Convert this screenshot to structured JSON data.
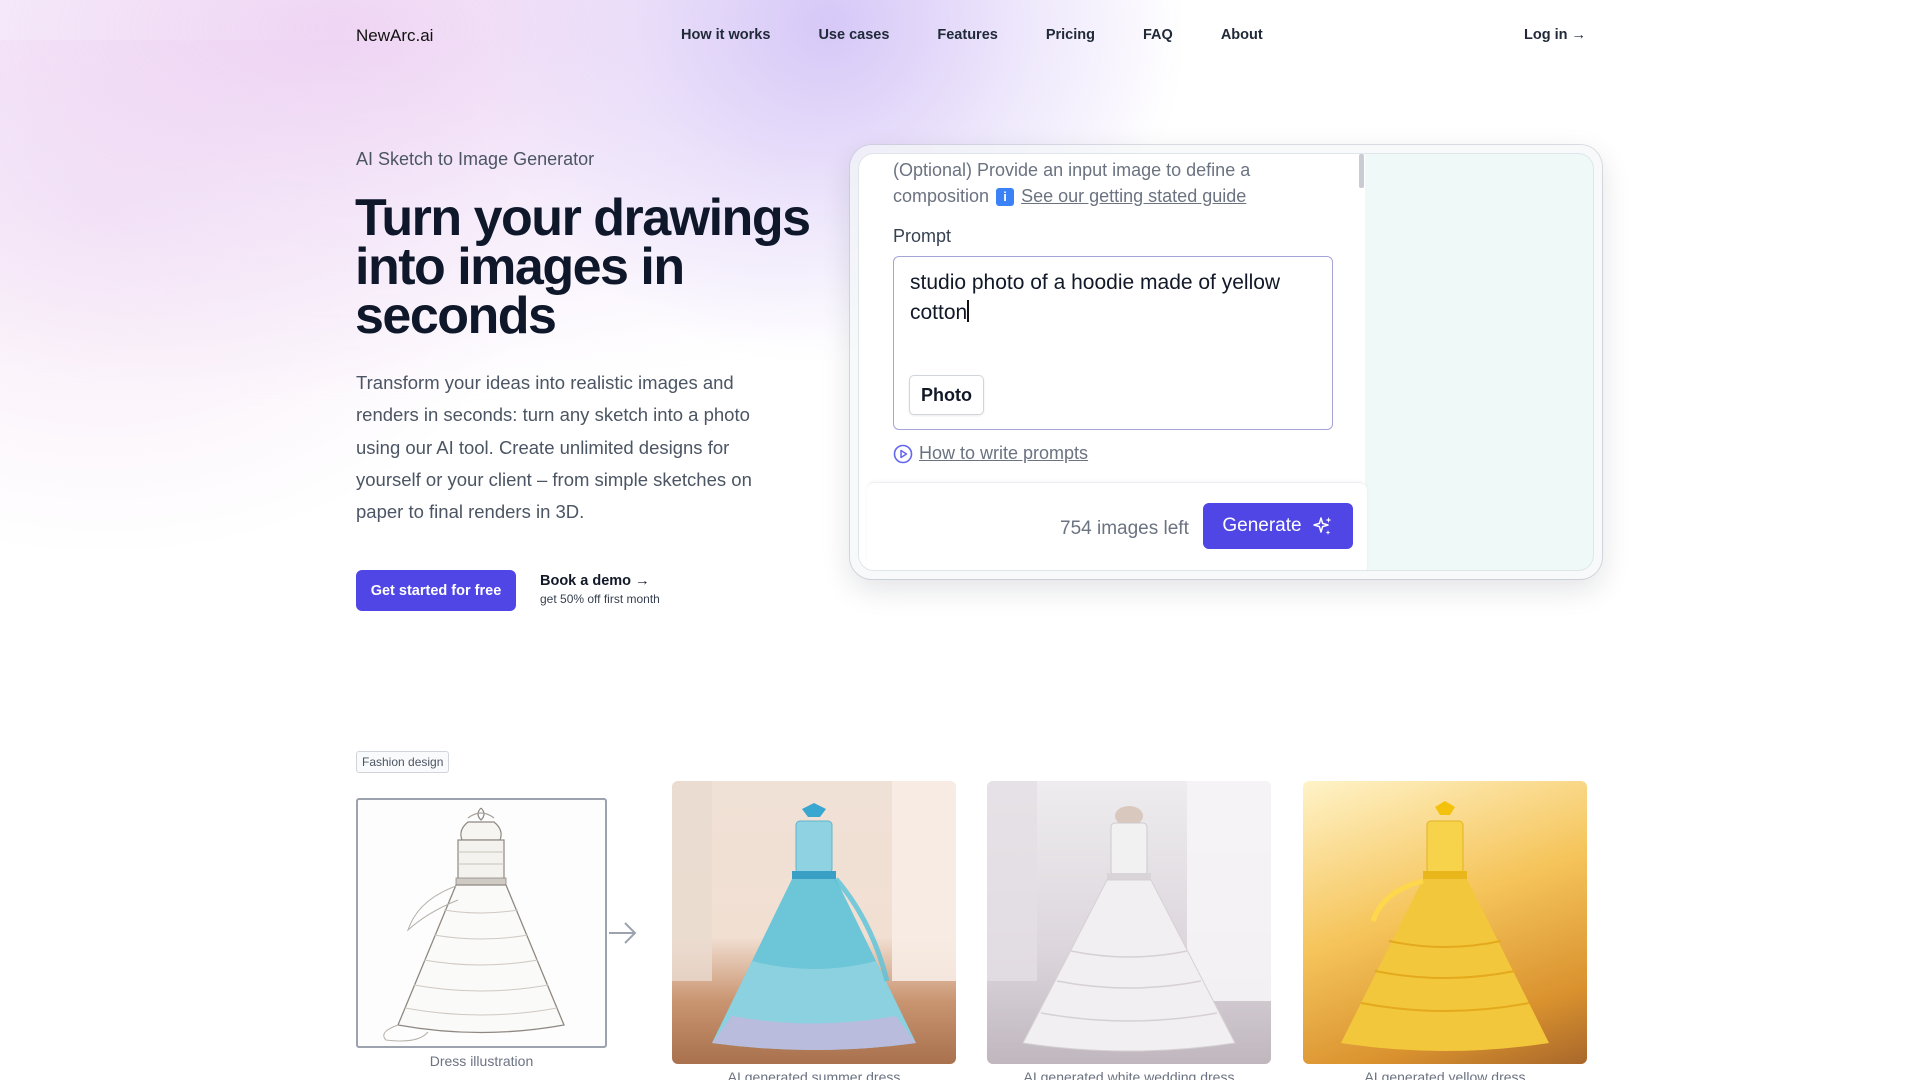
{
  "nav": {
    "brand": "NewArc.ai",
    "links": [
      "How it works",
      "Use cases",
      "Features",
      "Pricing",
      "FAQ",
      "About"
    ],
    "login": "Log in →"
  },
  "hero": {
    "eyebrow": "AI Sketch to Image Generator",
    "headline": "Turn your drawings into images in seconds",
    "description": "Transform your ideas into realistic images and renders in seconds: turn any sketch into a photo using our AI tool. Create unlimited designs for yourself or your client – from simple sketches on paper to final renders in 3D.",
    "cta_primary": "Get started for free",
    "cta_secondary_title": "Book a demo →",
    "cta_secondary_sub": "get 50% off first month"
  },
  "generator": {
    "optional_text_before": "(Optional) Provide an input image to define a composition",
    "info_icon_glyph": "i",
    "guide_link": "See our getting stated guide",
    "prompt_label": "Prompt",
    "prompt_value": "studio photo of a hoodie made of yellow cotton",
    "style_chip": "Photo",
    "howto_link": "How to write prompts",
    "images_left": "754 images left",
    "generate_label": "Generate"
  },
  "gallery": {
    "tag": "Fashion design",
    "sketch_caption": "Dress illustration",
    "items": [
      {
        "caption": "AI generated summer dress",
        "color": "#6cc6d8"
      },
      {
        "caption": "AI generated white wedding dress",
        "color": "#e6e3e6"
      },
      {
        "caption": "AI generated yellow dress",
        "color": "#f3c73c"
      }
    ]
  },
  "colors": {
    "accent": "#4f46e5"
  }
}
